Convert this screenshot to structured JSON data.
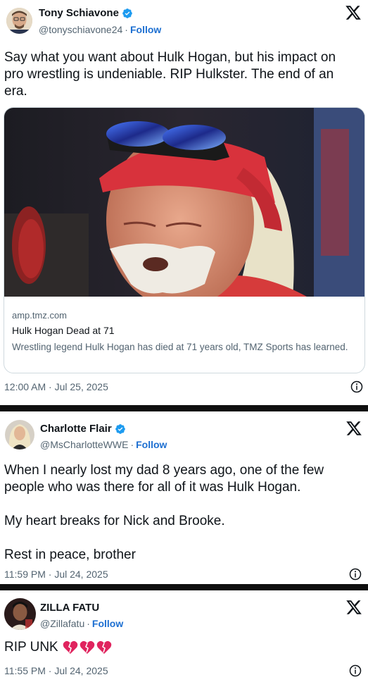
{
  "tweets": [
    {
      "name": "Tony Schiavone",
      "handle": "@tonyschiavone24",
      "follow": "Follow",
      "text": "Say what you want about Hulk Hogan, but his impact on\npro wrestling is undeniable. RIP Hulkster. The end of an\nera.",
      "card": {
        "domain": "amp.tmz.com",
        "title": "Hulk Hogan Dead at 71",
        "description": "Wrestling legend Hulk Hogan has died at 71 years old, TMZ Sports has learned."
      },
      "timestamp": "12:00 AM · Jul 25, 2025"
    },
    {
      "name": "Charlotte Flair",
      "handle": "@MsCharlotteWWE",
      "follow": "Follow",
      "text": "When I nearly lost my dad 8 years ago, one of the few\npeople who was there for all of it was Hulk Hogan.\n\nMy heart breaks for Nick and Brooke.\n\nRest in peace, brother",
      "timestamp": "11:59 PM · Jul 24, 2025"
    },
    {
      "name": "ZILLA FATU",
      "handle": "@Zillafatu",
      "follow": "Follow",
      "text": "RIP UNK",
      "emoji": "💔💔💔",
      "timestamp": "11:55 PM · Jul 24, 2025"
    }
  ],
  "colors": {
    "verified": "#1d9bf0",
    "follow": "#1d6fd1",
    "secondary_text": "#536471",
    "divider": "#0f0f0f"
  },
  "icons": [
    "verified-badge-icon",
    "x-logo-icon",
    "info-icon",
    "broken-heart-emoji"
  ]
}
